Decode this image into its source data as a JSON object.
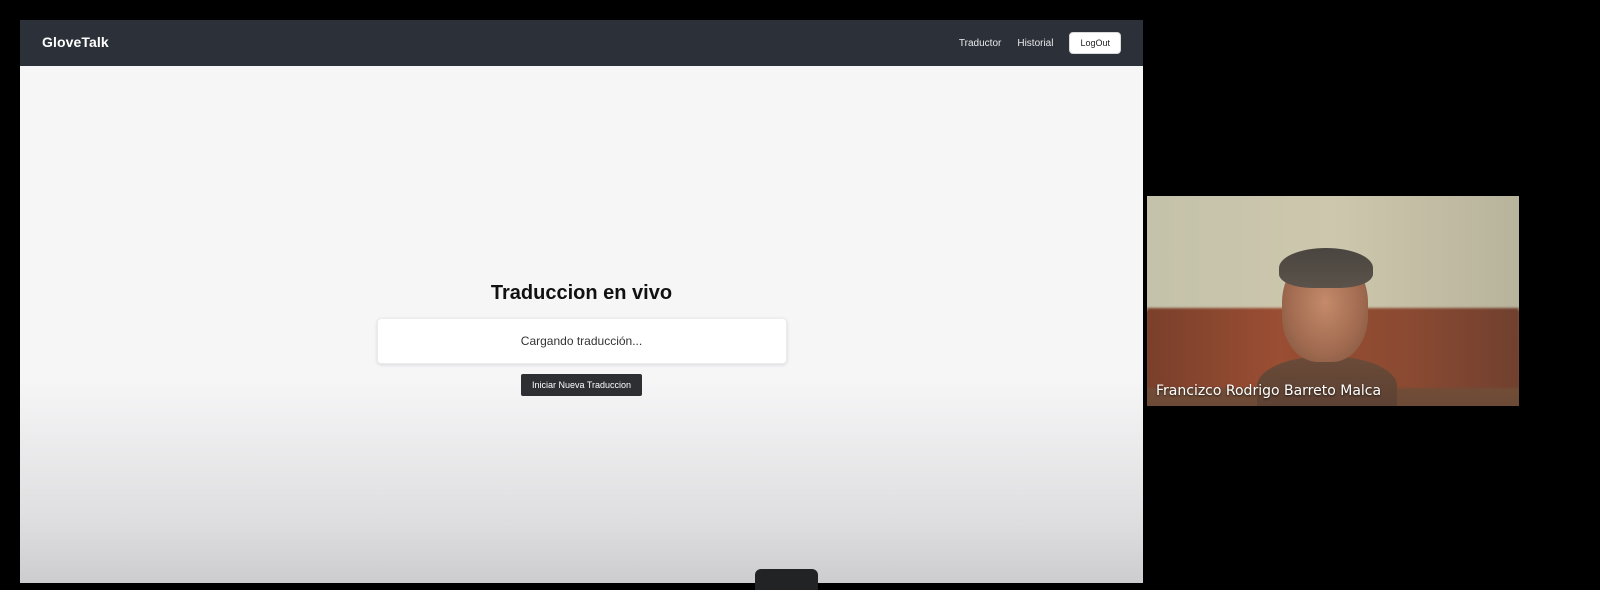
{
  "app": {
    "brand": "GloveTalk",
    "nav": {
      "links": [
        "Traductor",
        "Historial"
      ],
      "logout_label": "LogOut"
    }
  },
  "main": {
    "title": "Traduccion en vivo",
    "result_text": "Cargando traducción...",
    "new_translation_label": "Iniciar Nueva Traduccion"
  },
  "video": {
    "participant_name": "Francizco Rodrigo Barreto Malca"
  },
  "colors": {
    "navbar_bg": "#2c3038",
    "page_bg": "#f6f6f7",
    "button_dark": "#2d2f33",
    "outer_bg": "#000000"
  }
}
